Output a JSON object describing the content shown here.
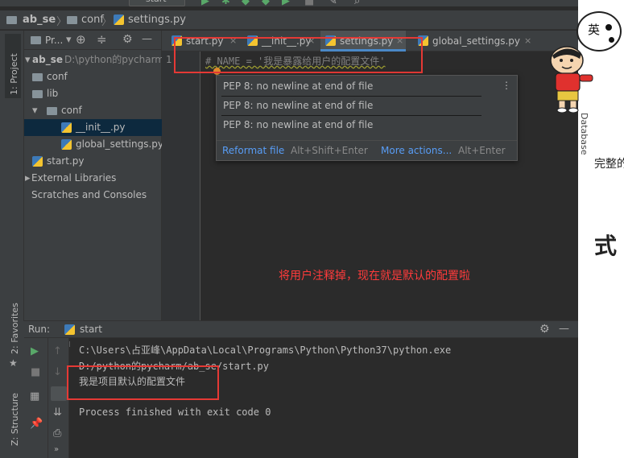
{
  "toolbar": {
    "run_config": "start"
  },
  "breadcrumb": {
    "root": "ab_se",
    "folder": "conf",
    "file": "settings.py"
  },
  "project_panel": {
    "title": "Pr...",
    "root_name": "ab_se",
    "root_path": "D:\\python的pycharm",
    "items": [
      {
        "label": "conf"
      },
      {
        "label": "lib"
      },
      {
        "label": "conf"
      },
      {
        "label": "__init__.py"
      },
      {
        "label": "global_settings.py"
      },
      {
        "label": "start.py"
      },
      {
        "label": "External Libraries"
      },
      {
        "label": "Scratches and Consoles"
      }
    ]
  },
  "left_stripe": {
    "project": "1: Project",
    "favorites": "2: Favorites",
    "structure": "Z: Structure"
  },
  "right_stripe": {
    "database": "Database"
  },
  "tabs": [
    {
      "label": "start.py"
    },
    {
      "label": "__init__.py"
    },
    {
      "label": "settings.py"
    },
    {
      "label": "global_settings.py"
    }
  ],
  "editor": {
    "line_number": "1",
    "code": "# NAME = '我是暴露给用户的配置文件'",
    "annotation": "将用户注释掉，现在就是默认的配置啦"
  },
  "popup": {
    "lines": [
      "PEP 8: no newline at end of file",
      "PEP 8: no newline at end of file",
      "PEP 8: no newline at end of file"
    ],
    "action_primary": "Reformat file",
    "action_primary_shortcut": "Alt+Shift+Enter",
    "action_more": "More actions...",
    "action_more_shortcut": "Alt+Enter"
  },
  "run": {
    "label": "Run:",
    "config": "start",
    "console": [
      "C:\\Users\\占亚峰\\AppData\\Local\\Programs\\Python\\Python37\\python.exe",
      " D:/python的pycharm/ab_se/start.py",
      "我是项目默认的配置文件",
      "Process finished with exit code 0"
    ]
  },
  "overlay": {
    "sticker_text": "英",
    "partial_text_1": "完整的",
    "partial_text_2": "式"
  },
  "colors": {
    "accent": "#4a88c7",
    "highlight": "#e53935"
  }
}
